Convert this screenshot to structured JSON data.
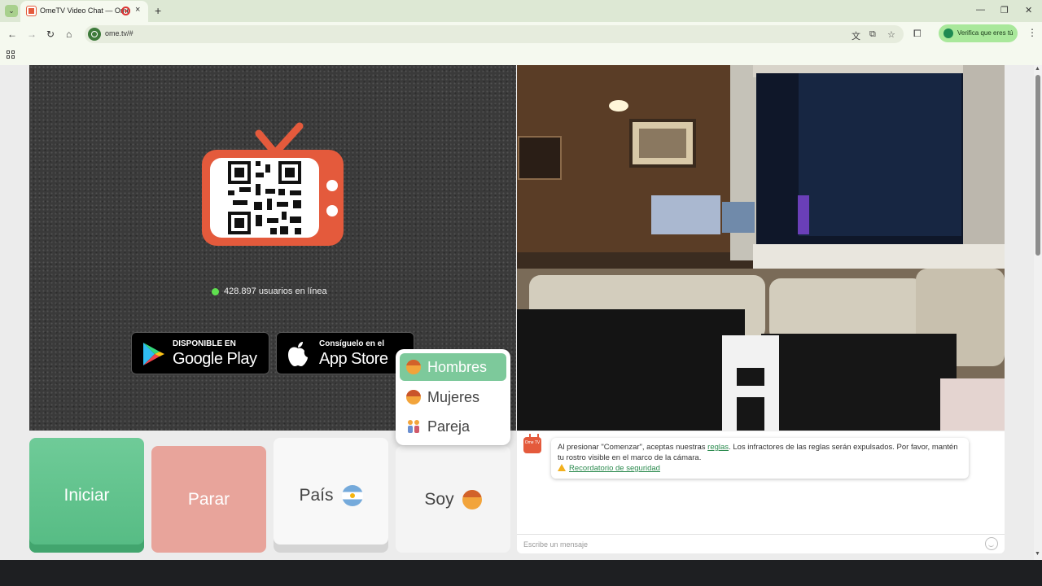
{
  "browser": {
    "tab_title": "OmeTV Video Chat — Ome",
    "tab_close": "×",
    "new_tab": "+",
    "url": "ome.tv/#",
    "profile_pill": "Verifica que eres tú",
    "window_controls": {
      "minimize": "—",
      "restore": "❐",
      "close": "✕"
    },
    "icons": [
      "back-icon",
      "forward-icon",
      "reload-icon",
      "home-icon",
      "translate-icon",
      "install-icon",
      "star-icon",
      "extensions-icon",
      "menu-icon",
      "apps-icon"
    ]
  },
  "hero": {
    "online_count_text": "428.897 usuarios en línea",
    "google_play": {
      "small": "DISPONIBLE EN",
      "big": "Google Play"
    },
    "app_store": {
      "small": "Consíguelo en el",
      "big": "App Store"
    }
  },
  "controls": {
    "start": "Iniciar",
    "stop": "Parar",
    "country": "País",
    "soy": "Soy"
  },
  "gender_menu": {
    "items": [
      {
        "label": "Hombres",
        "selected": true
      },
      {
        "label": "Mujeres",
        "selected": false
      },
      {
        "label": "Pareja",
        "selected": false
      }
    ]
  },
  "chat": {
    "logo_text": "Ome TV",
    "notice_pre": "Al presionar \"Comenzar\", aceptas nuestras ",
    "notice_link": "reglas",
    "notice_post": ". Los infractores de las reglas serán expulsados. Por favor, mantén tu rostro visible en el marco de la cámara.",
    "safety_link": "Recordatorio de seguridad",
    "input_placeholder": "Escribe un mensaje"
  },
  "colors": {
    "brand": "#e45a3c",
    "start_green": "#5fc08b",
    "stop_red": "#e8a49b",
    "online_green": "#5fe04f",
    "link_green": "#2b8a4e"
  }
}
